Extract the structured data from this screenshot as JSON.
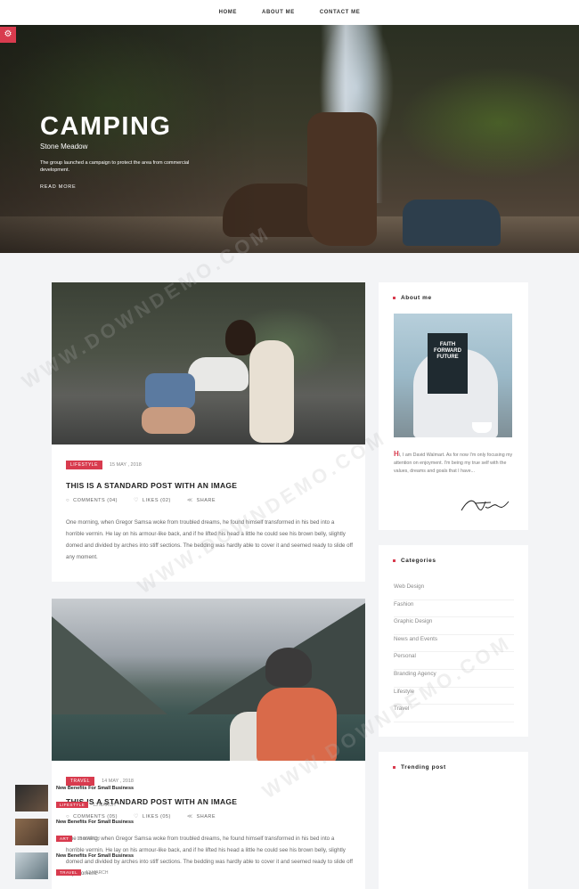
{
  "nav": {
    "items": [
      {
        "label": "HOME"
      },
      {
        "label": "ABOUT ME"
      },
      {
        "label": "CONTACT ME"
      }
    ]
  },
  "hero": {
    "title": "CAMPING",
    "subtitle": "Stone Meadow",
    "description": "The group launched a campaign to protect the area from commercial development.",
    "read_more": "READ MORE"
  },
  "settings_icon": "gear-icon",
  "posts": [
    {
      "category": "LIFESTYLE",
      "date": "15 MAY , 2018",
      "title": "THIS IS A STANDARD POST WITH AN IMAGE",
      "comments": "COMMENTS (04)",
      "likes": "LIKES (02)",
      "share": "SHARE",
      "excerpt": "One morning, when Gregor Samsa woke from troubled dreams, he found himself transformed in his bed into a horrible vermin. He lay on his armour-like back, and if he lifted his head a little he could see his brown belly, slightly domed and divided by arches into stiff sections. The bedding was hardly able to cover it and seemed ready to slide off any moment."
    },
    {
      "category": "TRAVEL",
      "date": "14 MAY , 2018",
      "title": "THIS IS A STANDARD POST WITH AN IMAGE",
      "comments": "COMMENTS (05)",
      "likes": "LIKES (05)",
      "share": "SHARE",
      "excerpt": "One morning, when Gregor Samsa woke from troubled dreams, he found himself transformed in his bed into a horrible vermin. He lay on his armour-like back, and if he lifted his head a little he could see his brown belly, slightly domed and divided by arches into stiff sections. The bedding was hardly able to cover it and seemed ready to slide off any moment."
    }
  ],
  "sidebar": {
    "about": {
      "title": "About me",
      "book_text": "FAITH FORWARD FUTURE",
      "dropcap": "H",
      "text": "i, I am David Walmart. As for now I'm only focusing my attention on enjoyment. I'm being my true self with the values, dreams and goals that I have..."
    },
    "categories": {
      "title": "Categories",
      "items": [
        "Web Design",
        "Fashion",
        "Graphic Design",
        "News and Events",
        "Personal",
        "Branding Agency",
        "Lifestyle",
        "Travel"
      ]
    },
    "trending": {
      "title": "Trending post",
      "items": [
        {
          "title": "New Benefits For Small Business",
          "category": "LIFESTYLE",
          "date": "13 MARCH"
        },
        {
          "title": "New Benefits For Small Business",
          "category": "ART",
          "date": "13 MARCH"
        },
        {
          "title": "New Benefits For Small Business",
          "category": "TRAVEL",
          "date": "13 MARCH"
        }
      ]
    }
  },
  "accent_color": "#d83b4e",
  "watermark": "WWW.DOWNDEMO.COM"
}
